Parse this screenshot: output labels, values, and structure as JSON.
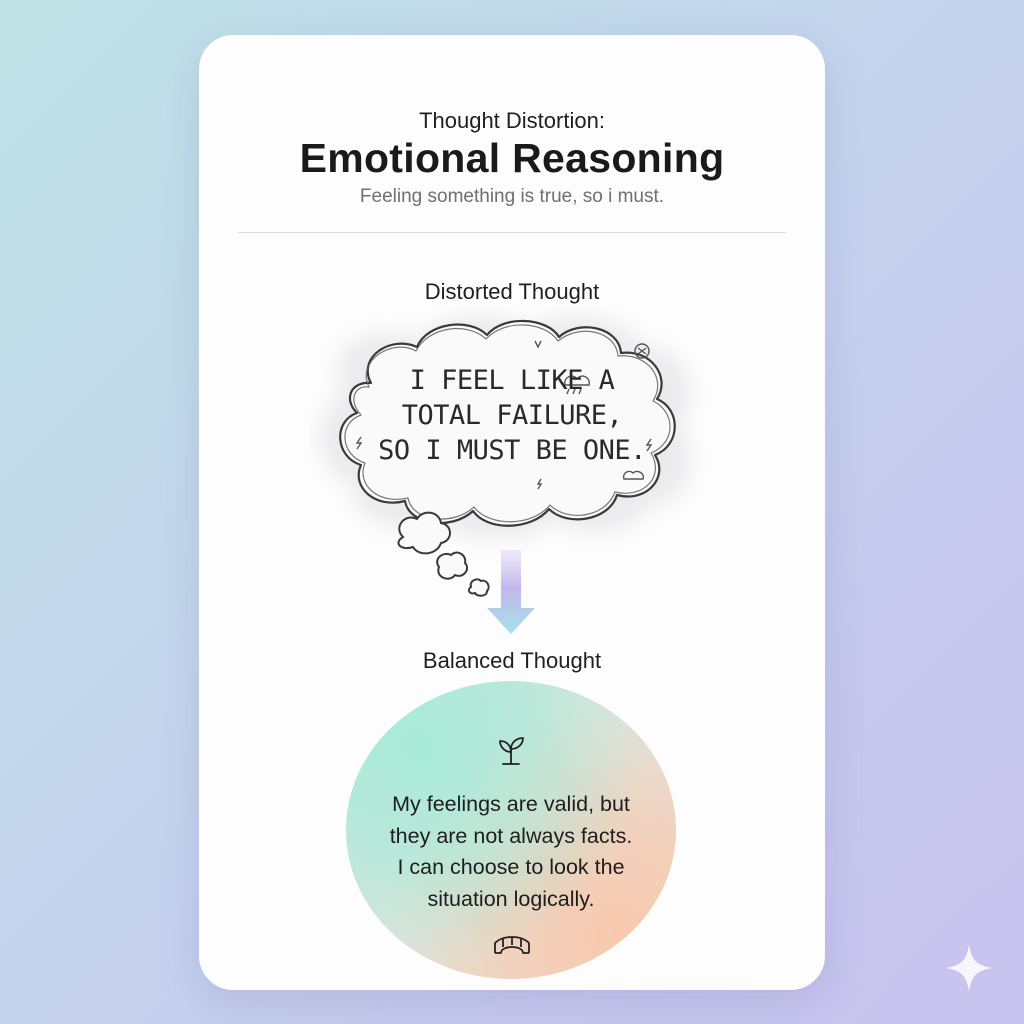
{
  "card": {
    "kicker": "Thought Distortion:",
    "title": "Emotional Reasoning",
    "subtitle": "Feeling something is true, so i must."
  },
  "distorted": {
    "label": "Distorted Thought",
    "lines": [
      "I FEEL LIKE A",
      "TOTAL FAILURE,",
      "SO I MUST BE ONE."
    ],
    "icons": [
      "rain-cloud-icon",
      "lightning-icon",
      "scribble-icon",
      "cloud-icon"
    ]
  },
  "balanced": {
    "label": "Balanced Thought",
    "lines": [
      "My feelings are valid, but",
      "they are not always facts.",
      "I can choose to look the",
      "situation logically."
    ],
    "top_icon": "sprout-icon",
    "bottom_icon": "bridge-icon"
  },
  "colors": {
    "background_start": "#bfe3e6",
    "background_end": "#c9c3ef",
    "card": "#fdfdfd",
    "mint": "#a9ead9",
    "peach": "#f8c9ae",
    "arrow_top": "#c7b8ec",
    "arrow_bottom": "#a6e3ea"
  },
  "decor": {
    "corner_icon": "sparkle-icon"
  }
}
